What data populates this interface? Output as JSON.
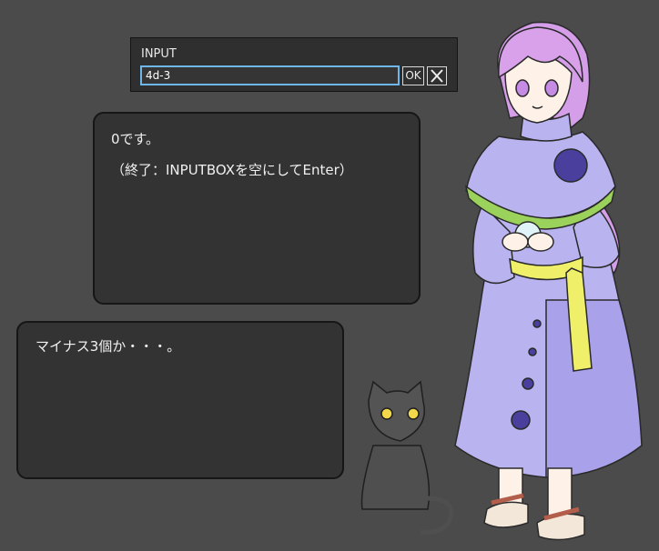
{
  "input_dialog": {
    "label": "INPUT",
    "value": "4d-3",
    "ok_label": "OK",
    "close_icon": "close-icon"
  },
  "message_main": {
    "line1": "0です。",
    "line2": "（終了：INPUTBOXを空にしてEnter）"
  },
  "message_sub": {
    "line1": "マイナス3個か・・・。"
  },
  "colors": {
    "background": "#4b4b4b",
    "panel": "#333333",
    "input_border": "#6fb6ea",
    "robe": "#b9b3ef",
    "hair": "#d9a1ea",
    "sash": "#f0ef6a",
    "cat": "#4a4a4a"
  }
}
